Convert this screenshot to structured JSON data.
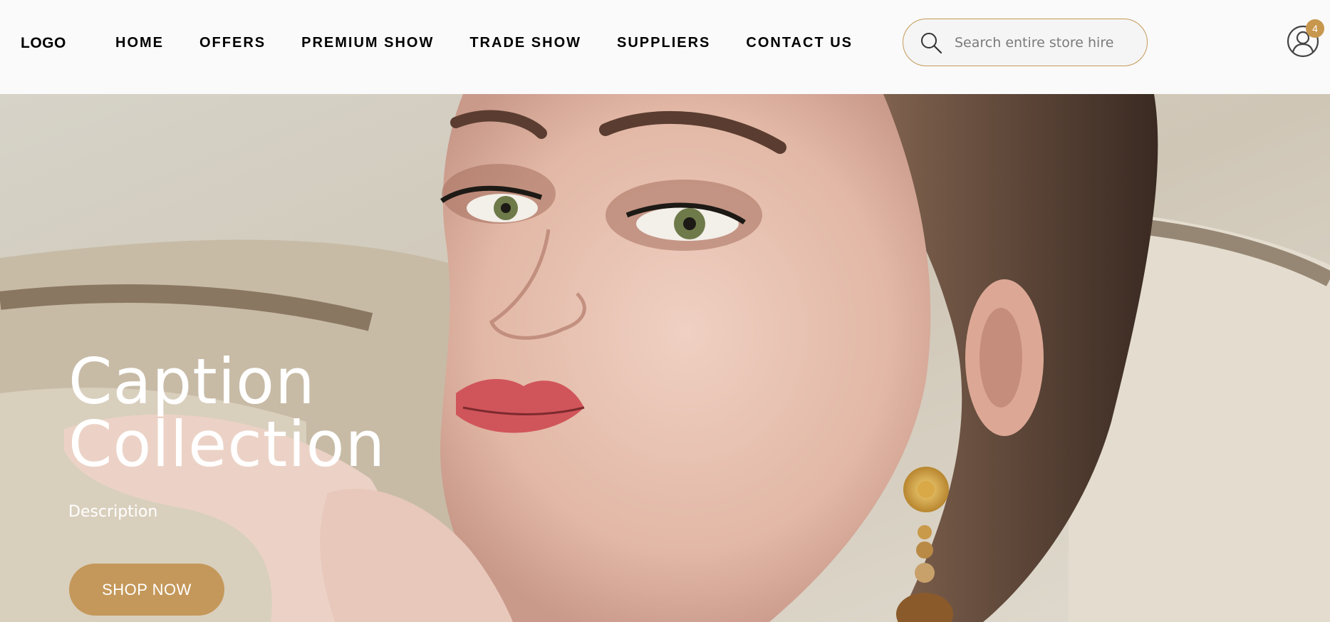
{
  "header": {
    "logo": "LOGO",
    "nav": [
      "HOME",
      "OFFERS",
      "PREMIUM SHOW",
      "TRADE SHOW",
      "SUPPLIERS",
      "CONTACT US"
    ],
    "search": {
      "placeholder": "Search entire store hire",
      "icon": "search-icon"
    },
    "account": {
      "icon": "user-icon",
      "badge_count": "4"
    }
  },
  "hero": {
    "title_line1": "Caption",
    "title_line2": "Collection",
    "description": "Description",
    "cta_label": "SHOP NOW",
    "image": "woman-portrait-with-gold-earring"
  },
  "colors": {
    "accent": "#c4985a",
    "header_bg": "#fafafa",
    "text": "#000000"
  }
}
